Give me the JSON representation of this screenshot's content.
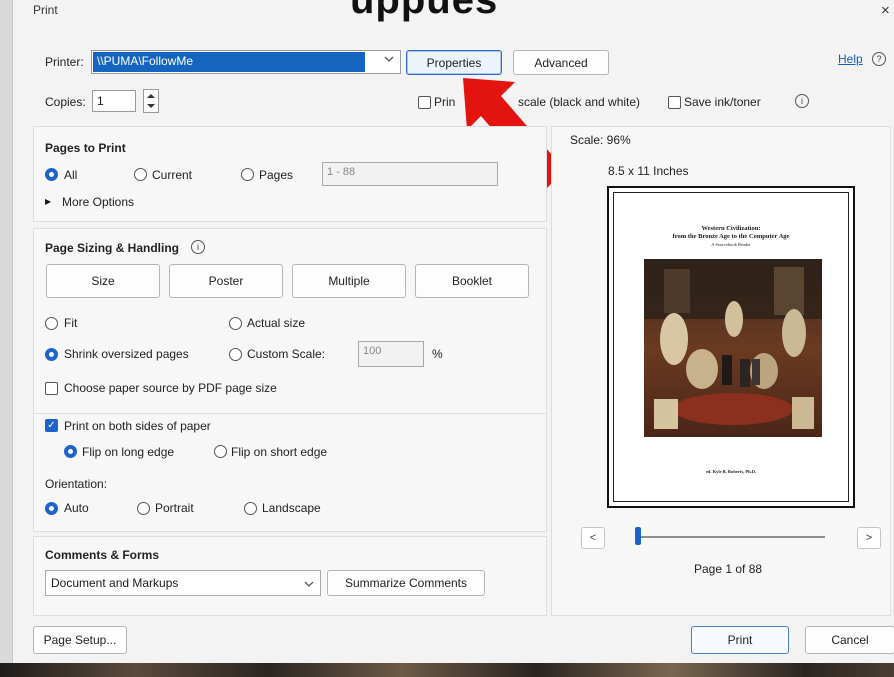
{
  "background_title": "uppues",
  "dialog": {
    "title": "Print",
    "close_glyph": "×"
  },
  "printer": {
    "label": "Printer:",
    "value": "\\\\PUMA\\FollowMe",
    "properties_label": "Properties",
    "advanced_label": "Advanced",
    "help_label": "Help",
    "help_icon": "?"
  },
  "copies": {
    "label": "Copies:",
    "value": "1"
  },
  "grayscale": {
    "label_part1": "Prin",
    "label_part2": "scale (black and white)",
    "checked": false
  },
  "save_ink": {
    "label": "Save ink/toner",
    "checked": false,
    "info_icon": "i"
  },
  "pages_to_print": {
    "title": "Pages to Print",
    "all_label": "All",
    "current_label": "Current",
    "pages_label": "Pages",
    "pages_value": "1 - 88",
    "more_options_label": "More Options",
    "selected": "All"
  },
  "page_sizing": {
    "title": "Page Sizing & Handling",
    "info_icon": "i",
    "tabs": [
      "Size",
      "Poster",
      "Multiple",
      "Booklet"
    ],
    "fit_label": "Fit",
    "actual_size_label": "Actual size",
    "shrink_label": "Shrink oversized pages",
    "custom_scale_label": "Custom Scale:",
    "custom_scale_value": "100",
    "percent_sign": "%",
    "paper_source_label": "Choose paper source by PDF page size",
    "selected": "Shrink oversized pages"
  },
  "duplex": {
    "print_both_label": "Print on both sides of paper",
    "print_both_checked": true,
    "flip_long_label": "Flip on long edge",
    "flip_short_label": "Flip on short edge",
    "selected": "Flip on long edge"
  },
  "orientation": {
    "label": "Orientation:",
    "auto_label": "Auto",
    "portrait_label": "Portrait",
    "landscape_label": "Landscape",
    "selected": "Auto"
  },
  "comments_forms": {
    "title": "Comments & Forms",
    "value": "Document and Markups",
    "summarize_label": "Summarize Comments"
  },
  "preview": {
    "scale_label": "Scale: 96%",
    "paper_size_label": "8.5 x 11 Inches",
    "doc_title_line1": "Western Civilization:",
    "doc_title_line2": "from the Bronze Age to the Computer Age",
    "doc_title_line3": "A Sourcebook Reader",
    "doc_author": "ed. Kyle B. Roberts, Ph.D.",
    "prev_label": "<",
    "next_label": ">",
    "page_indicator": "Page 1 of 88",
    "slider_fraction": 0.0
  },
  "footer": {
    "page_setup_label": "Page Setup...",
    "print_label": "Print",
    "cancel_label": "Cancel"
  },
  "colors": {
    "accent": "#1d63c9",
    "selection": "#1565c0",
    "arrow": "#e3140f"
  },
  "icons": {
    "dropdown": "chevron-down-icon",
    "spin_up": "triangle-up-icon",
    "spin_down": "triangle-down-icon",
    "expand": "triangle-right-icon",
    "annotation": "red-arrow-icon"
  }
}
